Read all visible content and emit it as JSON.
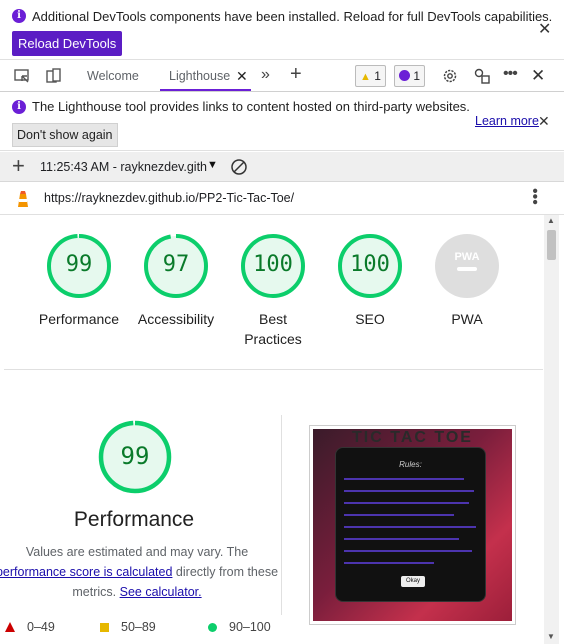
{
  "devtools_notice": {
    "message": "Additional DevTools components have been installed. Reload for full DevTools capabilities.",
    "reload_label": "Reload DevTools"
  },
  "tabs": [
    {
      "label": "Welcome"
    },
    {
      "label": "Lighthouse"
    }
  ],
  "badges": {
    "warnings": "1",
    "issues": "1"
  },
  "lighthouse_notice": {
    "message": "The Lighthouse tool provides links to content hosted on third-party websites.",
    "dismiss_label": "Don't show again",
    "learn_more_label": "Learn more"
  },
  "report": {
    "selected": "11:25:43 AM - rayknezdev.gith",
    "url": "https://rayknezdev.github.io/PP2-Tic-Tac-Toe/"
  },
  "gauges": [
    {
      "score": "99",
      "label": "Performance",
      "value": 0.99
    },
    {
      "score": "97",
      "label": "Accessibility",
      "value": 0.97
    },
    {
      "score": "100",
      "label": "Best Practices",
      "label_line1": "Best",
      "label_line2": "Practices",
      "value": 1.0
    },
    {
      "score": "100",
      "label": "SEO",
      "value": 1.0
    },
    {
      "score": "PWA",
      "label": "PWA",
      "value": null
    }
  ],
  "performance": {
    "score": "99",
    "value": 0.99,
    "title": "Performance",
    "desc_1": "Values are estimated and may vary. The",
    "desc_link_1": "performance score is calculated",
    "desc_2": "directly from these",
    "desc_3": "metrics.",
    "desc_link_2": "See calculator."
  },
  "legend": [
    {
      "range": "0–49",
      "color": "#cc0000"
    },
    {
      "range": "50–89",
      "color": "#e6b800"
    },
    {
      "range": "90–100",
      "color": "#0cce6b"
    }
  ],
  "screenshot": {
    "title": "TIC TAC TOE",
    "modal_title": "Rules:",
    "ok_label": "Okay"
  },
  "colors": {
    "accent": "#6b1fd6",
    "pass": "#0cce6b",
    "pass_text": "#0a7a2a",
    "link": "#1a0dab"
  }
}
